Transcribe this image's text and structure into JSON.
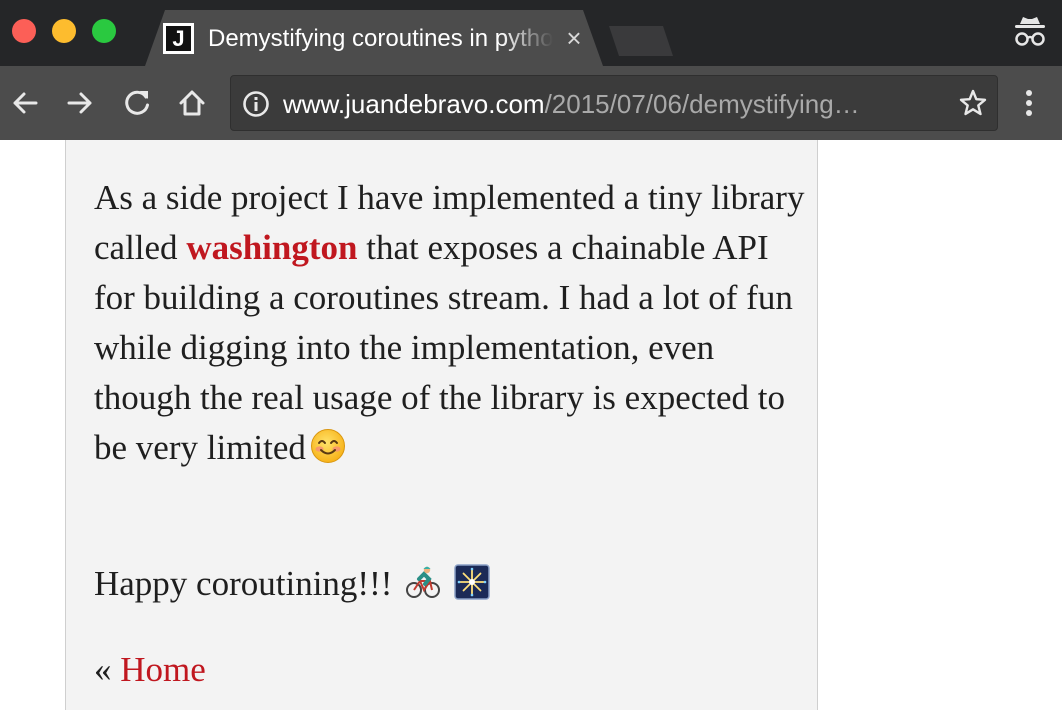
{
  "window": {
    "traffic_lights": [
      "close",
      "minimize",
      "maximize"
    ],
    "colors": {
      "close": "#fc5f57",
      "minimize": "#fdbc2e",
      "maximize": "#2ac940"
    }
  },
  "tab": {
    "favicon_letter": "J",
    "title": "Demystifying coroutines in python",
    "close_glyph": "×"
  },
  "toolbar": {
    "icons": [
      "back-arrow-icon",
      "forward-arrow-icon",
      "reload-icon",
      "home-icon",
      "info-icon",
      "bookmark-star-icon",
      "kebab-menu-icon",
      "incognito-icon"
    ],
    "url_host": "www.juandebravo.com",
    "url_path": "/2015/07/06/demystifying…"
  },
  "article": {
    "paragraph1_before": "As a side project I have implemented a tiny library called ",
    "library_link": "washington",
    "paragraph1_after": " that exposes a chainable API for building a coroutines stream. I had a lot of fun while digging into the implementation, even though the real usage of the library is expected to be very limited",
    "paragraph2": "Happy coroutining!!!",
    "emojis": [
      "smiling-face-emoji",
      "cyclist-emoji",
      "fireworks-emoji"
    ],
    "home_prefix": "« ",
    "home_link": "Home"
  },
  "colors": {
    "link": "#c0171f",
    "article_bg": "#f3f3f3",
    "chrome_dark": "#252628",
    "chrome_toolbar": "#4c4c4c"
  }
}
